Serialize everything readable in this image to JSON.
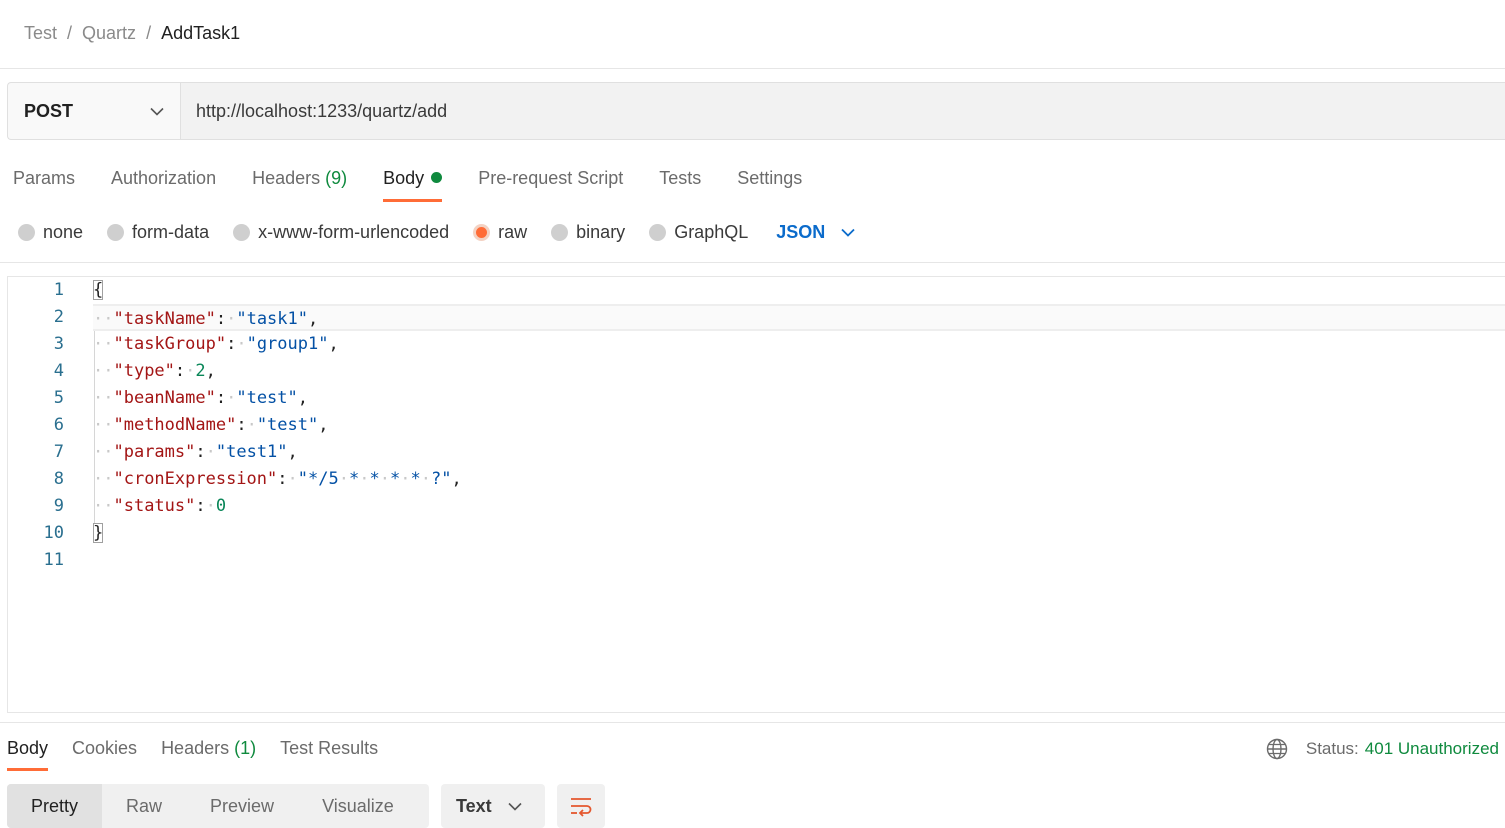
{
  "breadcrumb": {
    "items": [
      "Test",
      "Quartz"
    ],
    "current": "AddTask1",
    "separator": "/"
  },
  "request": {
    "method": "POST",
    "url": "http://localhost:1233/quartz/add"
  },
  "request_tabs": {
    "params": "Params",
    "authorization": "Authorization",
    "headers": "Headers",
    "headers_count": "(9)",
    "body": "Body",
    "prerequest": "Pre-request Script",
    "tests": "Tests",
    "settings": "Settings"
  },
  "body_types": {
    "none": "none",
    "form_data": "form-data",
    "urlencoded": "x-www-form-urlencoded",
    "raw": "raw",
    "binary": "binary",
    "graphql": "GraphQL",
    "selected": "raw",
    "language": "JSON"
  },
  "editor": {
    "line_numbers": [
      "1",
      "2",
      "3",
      "4",
      "5",
      "6",
      "7",
      "8",
      "9",
      "10",
      "11"
    ],
    "lines": [
      {
        "tokens": [
          [
            "brace",
            "{"
          ]
        ]
      },
      {
        "tokens": [
          [
            "ws",
            "··"
          ],
          [
            "key",
            "\"taskName\""
          ],
          [
            "p",
            ":"
          ],
          [
            "ws",
            "·"
          ],
          [
            "str",
            "\"task1\""
          ],
          [
            "p",
            ","
          ]
        ]
      },
      {
        "tokens": [
          [
            "ws",
            "··"
          ],
          [
            "key",
            "\"taskGroup\""
          ],
          [
            "p",
            ":"
          ],
          [
            "ws",
            "·"
          ],
          [
            "str",
            "\"group1\""
          ],
          [
            "p",
            ","
          ]
        ]
      },
      {
        "tokens": [
          [
            "ws",
            "··"
          ],
          [
            "key",
            "\"type\""
          ],
          [
            "p",
            ":"
          ],
          [
            "ws",
            "·"
          ],
          [
            "num",
            "2"
          ],
          [
            "p",
            ","
          ]
        ]
      },
      {
        "tokens": [
          [
            "ws",
            "··"
          ],
          [
            "key",
            "\"beanName\""
          ],
          [
            "p",
            ":"
          ],
          [
            "ws",
            "·"
          ],
          [
            "str",
            "\"test\""
          ],
          [
            "p",
            ","
          ]
        ]
      },
      {
        "tokens": [
          [
            "ws",
            "··"
          ],
          [
            "key",
            "\"methodName\""
          ],
          [
            "p",
            ":"
          ],
          [
            "ws",
            "·"
          ],
          [
            "str",
            "\"test\""
          ],
          [
            "p",
            ","
          ]
        ]
      },
      {
        "tokens": [
          [
            "ws",
            "··"
          ],
          [
            "key",
            "\"params\""
          ],
          [
            "p",
            ":"
          ],
          [
            "ws",
            "·"
          ],
          [
            "str",
            "\"test1\""
          ],
          [
            "p",
            ","
          ]
        ]
      },
      {
        "tokens": [
          [
            "ws",
            "··"
          ],
          [
            "key",
            "\"cronExpression\""
          ],
          [
            "p",
            ":"
          ],
          [
            "ws",
            "·"
          ],
          [
            "str",
            "\"*/5"
          ],
          [
            "ws",
            "·"
          ],
          [
            "str",
            "*"
          ],
          [
            "ws",
            "·"
          ],
          [
            "str",
            "*"
          ],
          [
            "ws",
            "·"
          ],
          [
            "str",
            "*"
          ],
          [
            "ws",
            "·"
          ],
          [
            "str",
            "*"
          ],
          [
            "ws",
            "·"
          ],
          [
            "str",
            "?\""
          ],
          [
            "p",
            ","
          ]
        ]
      },
      {
        "tokens": [
          [
            "ws",
            "··"
          ],
          [
            "key",
            "\"status\""
          ],
          [
            "p",
            ":"
          ],
          [
            "ws",
            "·"
          ],
          [
            "num",
            "0"
          ]
        ]
      },
      {
        "tokens": [
          [
            "brace",
            "}"
          ]
        ]
      },
      {
        "tokens": []
      }
    ]
  },
  "response_tabs": {
    "body": "Body",
    "cookies": "Cookies",
    "headers": "Headers",
    "headers_count": "(1)",
    "test_results": "Test Results"
  },
  "status": {
    "label": "Status:",
    "value": "401 Unauthorized"
  },
  "view_modes": {
    "pretty": "Pretty",
    "raw": "Raw",
    "preview": "Preview",
    "visualize": "Visualize"
  },
  "format": "Text",
  "icons": {
    "dropdown": "chevron-down-icon",
    "globe": "globe-icon",
    "wrap": "text-wrap-icon"
  },
  "colors": {
    "accent": "#ff6c37",
    "success": "#0f8a3e",
    "link": "#0b6bcb",
    "json_key": "#a31515",
    "json_string": "#0451a5",
    "json_number": "#098658"
  }
}
